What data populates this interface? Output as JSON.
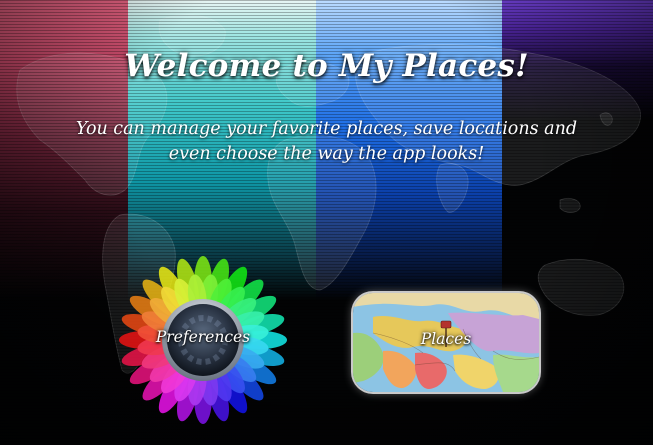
{
  "header": {
    "title": "Welcome to My Places!",
    "subtitle": "You can manage your favorite places, save locations and even choose the way the app looks!"
  },
  "buttons": {
    "preferences": {
      "label": "Preferences",
      "icon": "color-wheel-icon"
    },
    "places": {
      "label": "Places",
      "icon": "map-pin-icon"
    }
  },
  "colors": {
    "band_pink": "#c24766",
    "band_teal": "#3fc8c9",
    "band_blue": "#1f6fe6",
    "band_purple": "#4a2397",
    "text": "#ffffff"
  }
}
